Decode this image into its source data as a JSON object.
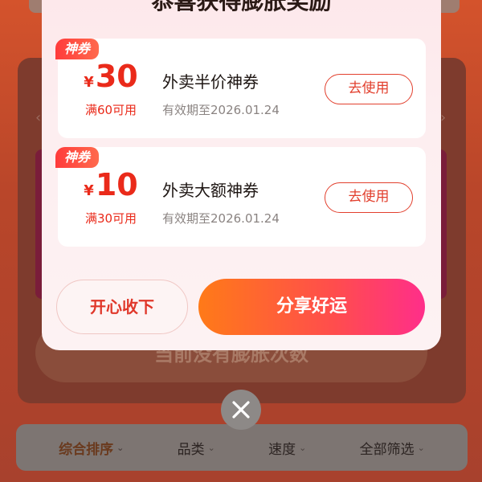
{
  "background": {
    "main_button": "当前没有膨胀次数",
    "filters": [
      {
        "label": "综合排序",
        "active": true
      },
      {
        "label": "品类",
        "active": false
      },
      {
        "label": "速度",
        "active": false
      },
      {
        "label": "全部筛选",
        "active": false
      }
    ]
  },
  "modal": {
    "title": "恭喜获得膨胀奖励",
    "coupons": [
      {
        "tag": "神券",
        "currency": "¥",
        "amount": "30",
        "condition": "满60可用",
        "name": "外卖半价神券",
        "validity": "有效期至2026.01.24",
        "button": "去使用"
      },
      {
        "tag": "神券",
        "currency": "¥",
        "amount": "10",
        "condition": "满30可用",
        "name": "外卖大额神券",
        "validity": "有效期至2026.01.24",
        "button": "去使用"
      }
    ],
    "accept_button": "开心收下",
    "share_button": "分享好运"
  },
  "close_icon": "close-icon",
  "colors": {
    "accent_red": "#ea2a1a",
    "share_gradient_start": "#ff7a18",
    "share_gradient_end": "#ff2e8a"
  }
}
